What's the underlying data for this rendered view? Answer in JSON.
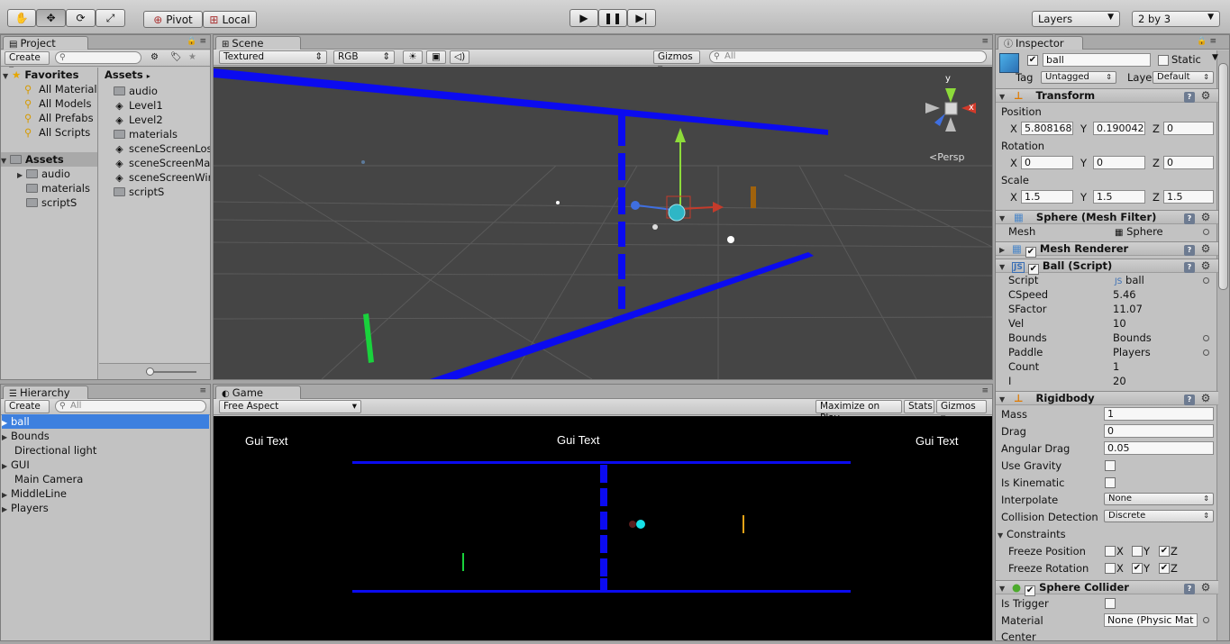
{
  "toolbar": {
    "pivot": "Pivot",
    "local": "Local",
    "layers": "Layers",
    "layout": "2 by 3"
  },
  "project": {
    "tab": "Project",
    "create": "Create",
    "favorites_header": "Favorites",
    "favorites": [
      "All Material",
      "All Models",
      "All Prefabs",
      "All Scripts"
    ],
    "assets_header": "Assets",
    "assets_tree": [
      "audio",
      "materials",
      "scriptS"
    ],
    "assets_breadcrumb": "Assets",
    "assets_items": [
      "audio",
      "Level1",
      "Level2",
      "materials",
      "sceneScreenLos",
      "sceneScreenMa",
      "sceneScreenWir",
      "scriptS"
    ]
  },
  "scene": {
    "tab": "Scene",
    "render_mode": "Textured",
    "color_mode": "RGB",
    "gizmos": "Gizmos",
    "search_placeholder": "All",
    "persp": "Persp",
    "gizmo_y": "y",
    "gizmo_x": "x"
  },
  "hierarchy": {
    "tab": "Hierarchy",
    "create": "Create",
    "search_placeholder": "All",
    "items": [
      "ball",
      "Bounds",
      "Directional light",
      "GUI",
      "Main Camera",
      "MiddleLine",
      "Players"
    ]
  },
  "game": {
    "tab": "Game",
    "aspect": "Free Aspect",
    "maximize": "Maximize on Play",
    "stats": "Stats",
    "gizmos": "Gizmos",
    "gui_left": "Gui Text",
    "gui_center": "Gui Text",
    "gui_right": "Gui Text"
  },
  "inspector": {
    "tab": "Inspector",
    "object_name": "ball",
    "static": "Static",
    "tag_label": "Tag",
    "tag_value": "Untagged",
    "layer_label": "Layer",
    "layer_value": "Default",
    "transform": {
      "title": "Transform",
      "position": "Position",
      "rotation": "Rotation",
      "scale": "Scale",
      "pos": [
        "5.808168",
        "0.190042",
        "0"
      ],
      "rot": [
        "0",
        "0",
        "0"
      ],
      "scl": [
        "1.5",
        "1.5",
        "1.5"
      ]
    },
    "mesh_filter": {
      "title": "Sphere (Mesh Filter)",
      "mesh_label": "Mesh",
      "mesh_value": "Sphere"
    },
    "mesh_renderer": {
      "title": "Mesh Renderer"
    },
    "ball_script": {
      "title": "Ball (Script)",
      "fields": [
        {
          "label": "Script",
          "value": "ball"
        },
        {
          "label": "CSpeed",
          "value": "5.46"
        },
        {
          "label": "SFactor",
          "value": "11.07"
        },
        {
          "label": "Vel",
          "value": "10"
        },
        {
          "label": "Bounds",
          "value": "Bounds"
        },
        {
          "label": "Paddle",
          "value": "Players"
        },
        {
          "label": "Count",
          "value": "1"
        },
        {
          "label": "I",
          "value": "20"
        }
      ]
    },
    "rigidbody": {
      "title": "Rigidbody",
      "mass_label": "Mass",
      "mass": "1",
      "drag_label": "Drag",
      "drag": "0",
      "angular_label": "Angular Drag",
      "angular": "0.05",
      "gravity_label": "Use Gravity",
      "kinematic_label": "Is Kinematic",
      "interpolate_label": "Interpolate",
      "interpolate": "None",
      "collision_label": "Collision Detection",
      "collision": "Discrete",
      "constraints_label": "Constraints",
      "freeze_pos_label": "Freeze Position",
      "freeze_rot_label": "Freeze Rotation"
    },
    "sphere_collider": {
      "title": "Sphere Collider",
      "trigger_label": "Is Trigger",
      "material_label": "Material",
      "material_value": "None (Physic Mat",
      "center_label": "Center"
    }
  },
  "colors": {
    "selection": "#3d80df",
    "wall": "#0b0bf0",
    "paddle_left": "#19d23c",
    "paddle_right": "#e8a317",
    "ball": "#16e1e8"
  }
}
